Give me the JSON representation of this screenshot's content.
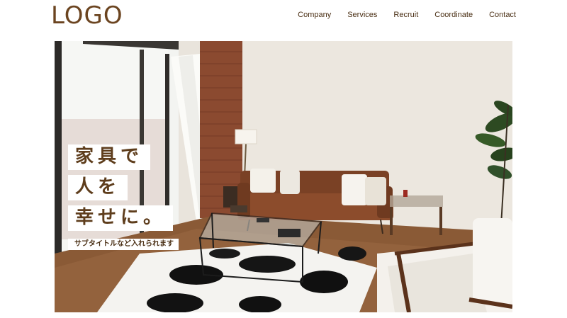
{
  "header": {
    "logo": "LOGO",
    "nav": [
      "Company",
      "Services",
      "Recruit",
      "Coordinate",
      "Contact"
    ]
  },
  "hero": {
    "catch_lines": [
      "家具で",
      "人を",
      "幸せに。"
    ],
    "subtitle": "サブタイトルなど入れられます"
  },
  "colors": {
    "brand_brown": "#6b4420",
    "text_brown": "#5e3d1c"
  }
}
